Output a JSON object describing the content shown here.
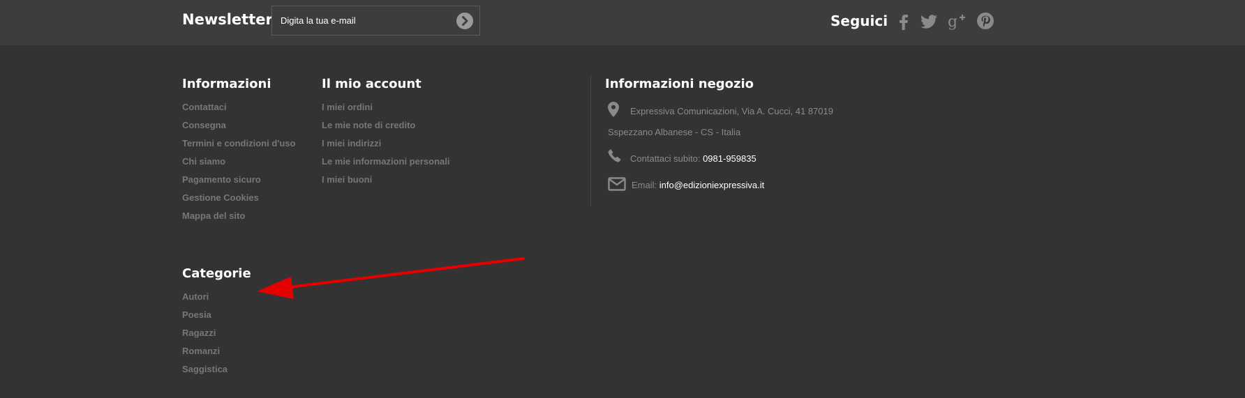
{
  "newsletter": {
    "title": "Newsletter",
    "placeholder": "Digita la tua e-mail",
    "submit_icon": "chevron-right-circle-icon"
  },
  "social": {
    "title": "Seguici",
    "icons": [
      "facebook-icon",
      "twitter-icon",
      "google-plus-icon",
      "pinterest-icon"
    ]
  },
  "informazioni": {
    "title": "Informazioni",
    "items": [
      "Contattaci",
      "Consegna",
      "Termini e condizioni d'uso",
      "Chi siamo",
      "Pagamento sicuro",
      "Gestione Cookies",
      "Mappa del sito"
    ]
  },
  "account": {
    "title": "Il mio account",
    "items": [
      "I miei ordini",
      "Le mie note di credito",
      "I miei indirizzi",
      "Le mie informazioni personali",
      "I miei buoni"
    ]
  },
  "negozio": {
    "title": "Informazioni negozio",
    "address_line1": "Expressiva Comunicazioni, Via A. Cucci, 41 87019",
    "address_line2": "Sspezzano Albanese - CS - Italia",
    "phone_label": "Contattaci subito:",
    "phone": "0981-959835",
    "email_label": "Email:",
    "email": "info@edizioniexpressiva.it"
  },
  "categorie": {
    "title": "Categorie",
    "items": [
      "Autori",
      "Poesia",
      "Ragazzi",
      "Romanzi",
      "Saggistica"
    ]
  },
  "colors": {
    "background": "#333333",
    "topbar": "#3d3d3d",
    "link": "#777777",
    "annotation_arrow": "#e60000"
  }
}
